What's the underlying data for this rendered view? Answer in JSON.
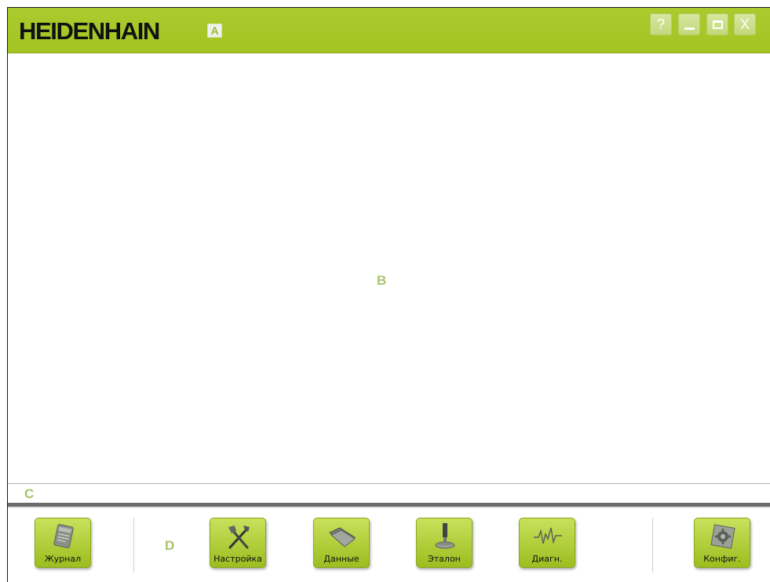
{
  "titlebar": {
    "brand": "HEIDENHAIN",
    "marker": "A",
    "buttons": {
      "help": "?",
      "minimize": "minimize",
      "maximize": "maximize",
      "close": "X"
    }
  },
  "main": {
    "marker": "B"
  },
  "status": {
    "marker": "C"
  },
  "toolbar": {
    "marker": "D",
    "buttons": [
      {
        "label": "Журнал",
        "icon": "log-icon"
      },
      {
        "label": "Настройка",
        "icon": "tools-icon"
      },
      {
        "label": "Данные",
        "icon": "folder-icon"
      },
      {
        "label": "Эталон",
        "icon": "reference-probe-icon"
      },
      {
        "label": "Диагн.",
        "icon": "waveform-icon"
      },
      {
        "label": "Конфиг.",
        "icon": "gear-icon"
      }
    ]
  },
  "colors": {
    "accent": "#a3c422",
    "marker": "#a8c46a",
    "window_button": "#c3d87b"
  }
}
